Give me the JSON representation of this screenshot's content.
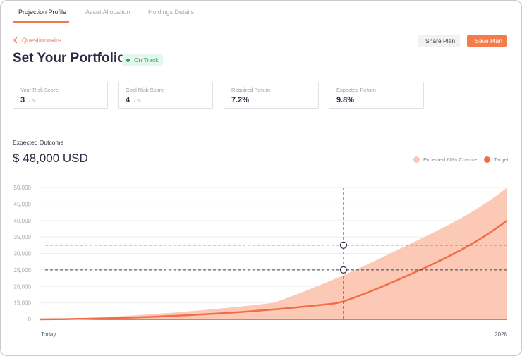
{
  "tabs": [
    {
      "label": "Projection Profile",
      "active": true
    },
    {
      "label": "Asset Allocation",
      "active": false
    },
    {
      "label": "Holdings Details",
      "active": false
    }
  ],
  "back_link": {
    "label": "Questionnaire",
    "icon": "chevron-left-icon"
  },
  "page": {
    "title": "Set Your Portfolio",
    "status_badge": "On Track"
  },
  "actions": {
    "share_label": "Share Plan",
    "save_label": "Save Plan"
  },
  "cards": [
    {
      "label": "Your Risk Score",
      "value": "3",
      "suffix": "/ 5"
    },
    {
      "label": "Goal Risk Score",
      "value": "4",
      "suffix": "/ 5"
    },
    {
      "label": "Required Return",
      "value": "7.2%",
      "suffix": ""
    },
    {
      "label": "Expected Return",
      "value": "9.8%",
      "suffix": ""
    }
  ],
  "outcome": {
    "label": "Expected Outcome",
    "value": "$ 48,000 USD"
  },
  "legend": [
    {
      "label": "Expected 60% Chance",
      "color": "#fcc9b7"
    },
    {
      "label": "Target",
      "color": "#f26d45"
    }
  ],
  "colors": {
    "accent": "#f37b4c",
    "band": "#fcc9b7",
    "target_line": "#f26d45",
    "on_track": "#22a25b"
  },
  "chart_data": {
    "type": "area",
    "x_labels": [
      "Today",
      "2028"
    ],
    "y_ticks": [
      "0",
      "15,000",
      "20,000",
      "25,000",
      "30,000",
      "35,000",
      "40,000",
      "45,000",
      "50,000"
    ],
    "ylim": [
      0,
      50000
    ],
    "grid": true,
    "series": [
      {
        "name": "Expected 60% Chance",
        "kind": "band",
        "x": [
          0,
          0.25,
          0.5,
          0.75,
          1.0
        ],
        "upper": [
          0,
          5000,
          15000,
          30000,
          50000
        ],
        "lower": [
          0,
          0,
          0,
          0,
          0
        ]
      },
      {
        "name": "Target",
        "kind": "line",
        "x": [
          0,
          0.25,
          0.5,
          0.75,
          1.0
        ],
        "values": [
          0,
          2500,
          9000,
          21000,
          40000
        ]
      }
    ],
    "markers": [
      {
        "x": 0.65,
        "y": 32500
      },
      {
        "x": 0.65,
        "y": 25000
      }
    ]
  }
}
